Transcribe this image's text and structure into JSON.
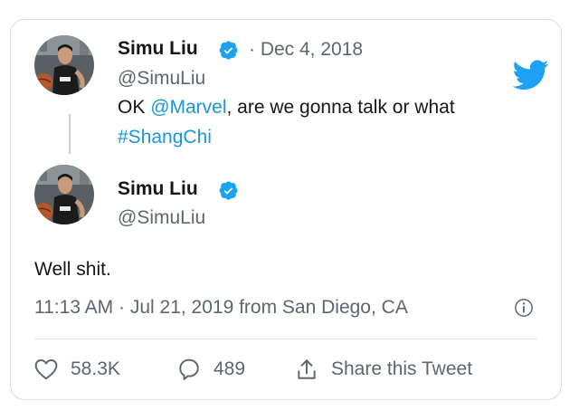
{
  "quoted_tweet": {
    "name": "Simu Liu",
    "handle": "@SimuLiu",
    "date": "· Dec 4, 2018",
    "text_before": "OK ",
    "mention": "@Marvel",
    "text_after": ", are we gonna talk or what",
    "hashtag": "#ShangChi"
  },
  "reply_tweet": {
    "name": "Simu Liu",
    "handle": "@SimuLiu",
    "text": "Well shit.",
    "meta": "11:13 AM · Jul 21, 2019 from San Diego, CA"
  },
  "actions": {
    "likes": "58.3K",
    "replies": "489",
    "share_label": "Share this Tweet"
  },
  "icons": {
    "brand": "twitter-bird-icon",
    "verified": "verified-badge-icon",
    "info": "info-icon",
    "like": "heart-icon",
    "reply": "reply-bubble-icon",
    "share": "share-icon"
  },
  "colors": {
    "brand_blue": "#1da1f2",
    "link_blue": "#1b95e0",
    "muted_text": "#5b6670",
    "border": "#d9dde1"
  }
}
